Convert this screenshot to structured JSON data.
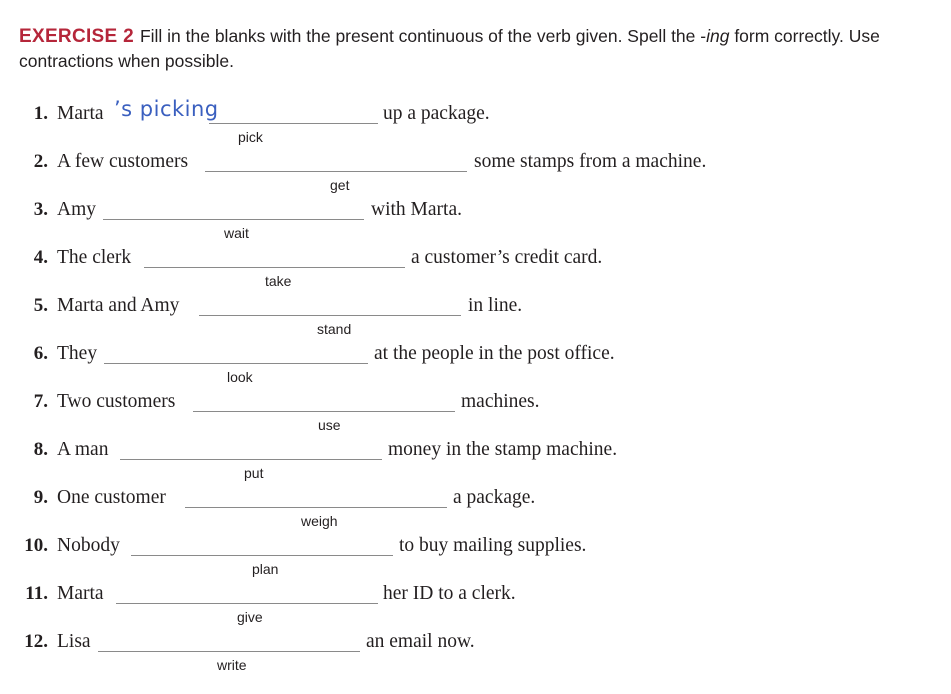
{
  "exercise": {
    "label": "EXERCISE 2",
    "instructions_part1": "Fill in the blanks with the present continuous of the verb given. Spell the -",
    "instructions_ing": "ing",
    "instructions_part2": " form correctly. Use contractions when possible."
  },
  "items": [
    {
      "number": "1.",
      "subject": "Marta",
      "answer": "’s picking",
      "verb": "pick",
      "rest": "up a package."
    },
    {
      "number": "2.",
      "subject": "A few customers",
      "answer": "",
      "verb": "get",
      "rest": "some stamps from a machine."
    },
    {
      "number": "3.",
      "subject": "Amy",
      "answer": "",
      "verb": "wait",
      "rest": "with Marta."
    },
    {
      "number": "4.",
      "subject": "The clerk",
      "answer": "",
      "verb": "take",
      "rest": "a customer’s credit card."
    },
    {
      "number": "5.",
      "subject": "Marta and Amy",
      "answer": "",
      "verb": "stand",
      "rest": "in line."
    },
    {
      "number": "6.",
      "subject": "They",
      "answer": "",
      "verb": "look",
      "rest": "at the people in the post office."
    },
    {
      "number": "7.",
      "subject": "Two customers",
      "answer": "",
      "verb": "use",
      "rest": "machines."
    },
    {
      "number": "8.",
      "subject": "A man",
      "answer": "",
      "verb": "put",
      "rest": "money in the stamp machine."
    },
    {
      "number": "9.",
      "subject": "One customer",
      "answer": "",
      "verb": "weigh",
      "rest": "a package."
    },
    {
      "number": "10.",
      "subject": "Nobody",
      "answer": "",
      "verb": "plan",
      "rest": "to buy mailing supplies."
    },
    {
      "number": "11.",
      "subject": "Marta",
      "answer": "",
      "verb": "give",
      "rest": "her ID to a clerk."
    },
    {
      "number": "12.",
      "subject": "Lisa",
      "answer": "",
      "verb": "write",
      "rest": "an email now."
    }
  ]
}
